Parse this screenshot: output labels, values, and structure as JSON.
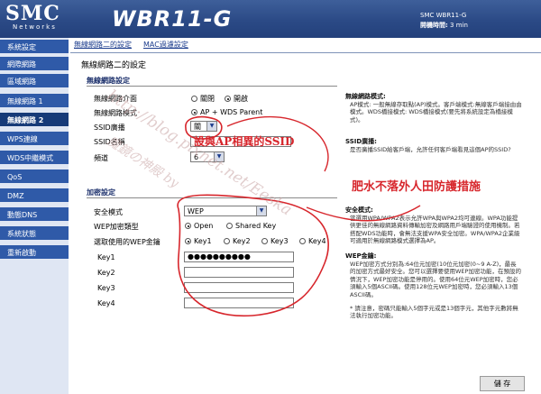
{
  "header": {
    "brand": "SMC",
    "brand_sub": "Networks",
    "product": "WBR11-G",
    "device_name": "SMC WBR11-G",
    "uptime_label": "開機時間:",
    "uptime_value": "3 min"
  },
  "sidebar": {
    "items": [
      {
        "label": "系統設定"
      },
      {
        "label": "網際網路"
      },
      {
        "label": "區域網路"
      },
      {
        "label": "無線網路 1"
      },
      {
        "label": "無線網路 2"
      },
      {
        "label": "WPS連線"
      },
      {
        "label": "WDS中繼模式"
      },
      {
        "label": "QoS"
      },
      {
        "label": "DMZ"
      },
      {
        "label": "動態DNS"
      },
      {
        "label": "系統狀態"
      },
      {
        "label": "重新啟動"
      }
    ],
    "active_index": 4
  },
  "tabs": [
    {
      "label": "無線網路二的設定"
    },
    {
      "label": "MAC過濾設定"
    }
  ],
  "page_title": "無線網路二的設定",
  "wireless": {
    "section_title": "無線網路設定",
    "interface_label": "無線網路介面",
    "interface_off": "關閉",
    "interface_on": "開啟",
    "interface_value": "開啟",
    "mode_label": "無線網路模式",
    "mode_option": "AP + WDS Parent",
    "ssid_broadcast_label": "SSID廣播",
    "ssid_broadcast_value": "關",
    "ssid_name_label": "SSID名稱",
    "ssid_name_value": "",
    "channel_label": "頻道",
    "channel_value": "6"
  },
  "security": {
    "section_title": "加密設定",
    "mode_label": "安全模式",
    "mode_value": "WEP",
    "wep_type_label": "WEP加密類型",
    "wep_type_open": "Open",
    "wep_type_shared": "Shared Key",
    "key_select_label": "選取使用的WEP金鑰",
    "keys": [
      {
        "label": "Key1",
        "option": "Key1",
        "value": "●●●●●●●●●●"
      },
      {
        "label": "Key2",
        "option": "Key2",
        "value": ""
      },
      {
        "label": "Key3",
        "option": "Key3",
        "value": ""
      },
      {
        "label": "Key4",
        "option": "Key4",
        "value": ""
      }
    ]
  },
  "help": {
    "mode_title": "無線網路模式:",
    "mode_text": "AP模式: 一般無線存取點(AP)模式。客戶端模式:無線客戶端接由由模式。WDS橋接模式: WDS橋接模式(要先將系統設定為橋接模式)。",
    "ssid_title": "SSID廣播:",
    "ssid_text": "是否廣播SSID給客戶端，允許任何客戶端看見這個AP的SSID?",
    "security_title": "安全模式:",
    "security_text": "當選用WPA/WPA2表示允許WPA與WPA2均可連線。WPA功能提供更佳的無線網路資料傳輸加密及網路用戶端驗證的使用機制。若搭配WDS功能時，會無法支援WPA安全加密。WPA/WPA2企業級可適用於無線網路模式選擇為AP。",
    "wep_title": "WEP金鑰:",
    "wep_text": "WEP加密方式分別為:64位元加密(10位元加密(0~9 A-Z)，最長的加密方式最好安全。您可以選擇要使用WEP加密功能，在預設的情況下，WEP加密功能是停用的。使用64位元WEP加密時，您必須輸入5個ASCII碼。使用128位元WEP加密時，您必須輸入13個ASCII碼。",
    "note_text": "* 請注意，密碼只能輸入5個字元或是13個字元，其他字元數將無法執行加密功能。"
  },
  "save_label": "儲 存",
  "annotations": {
    "ssid_note": "設與AP相異的SSID",
    "security_note": "肥水不落外人田防護措施",
    "watermark": "http://blog.pixnet.net/Eeska",
    "watermark_cn": "魔鏡の神殿 by"
  },
  "colors": {
    "header": "#2b4a86",
    "sidebar_item": "#2f5aa8",
    "sidebar_active": "#163a78",
    "ink": "#d7262c"
  }
}
